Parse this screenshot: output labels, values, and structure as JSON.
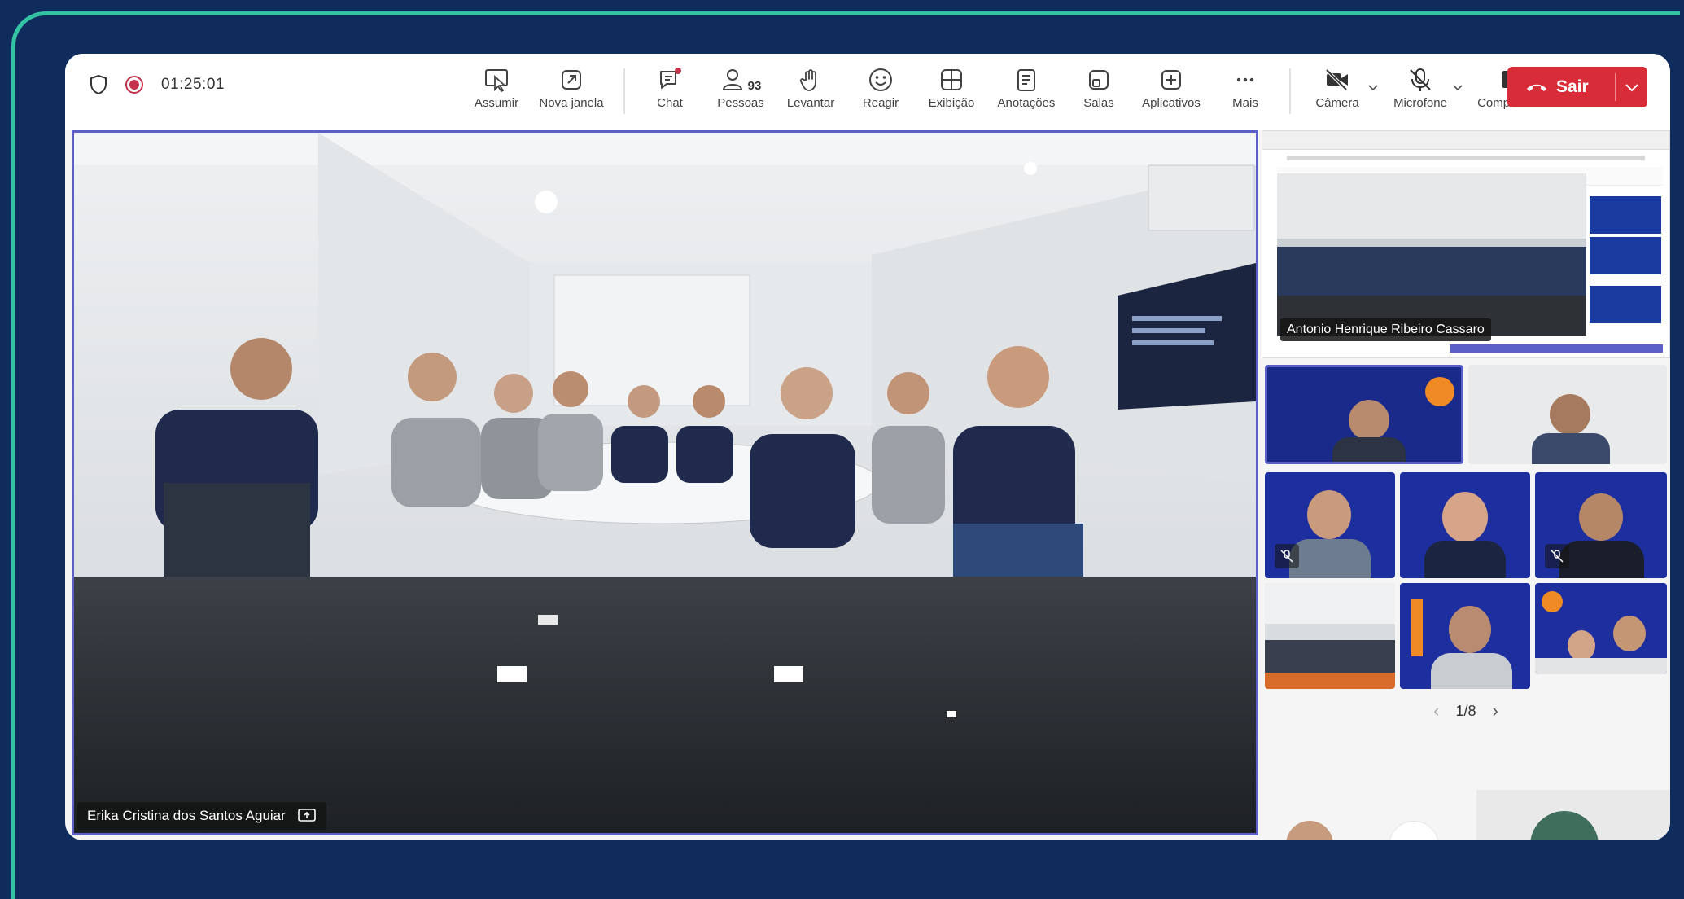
{
  "call": {
    "timer": "01:25:01"
  },
  "toolbar": {
    "items": [
      {
        "label": "Assumir",
        "icon": "take-control-icon"
      },
      {
        "label": "Nova janela",
        "icon": "pop-out-icon"
      },
      {
        "label": "Chat",
        "icon": "chat-icon"
      },
      {
        "label": "Pessoas",
        "icon": "people-icon",
        "count": "93"
      },
      {
        "label": "Levantar",
        "icon": "raise-hand-icon"
      },
      {
        "label": "Reagir",
        "icon": "react-icon"
      },
      {
        "label": "Exibição",
        "icon": "view-icon"
      },
      {
        "label": "Anotações",
        "icon": "notes-icon"
      },
      {
        "label": "Salas",
        "icon": "rooms-icon"
      },
      {
        "label": "Aplicativos",
        "icon": "apps-icon"
      },
      {
        "label": "Mais",
        "icon": "more-icon"
      },
      {
        "label": "Câmera",
        "icon": "camera-off-icon"
      },
      {
        "label": "Microfone",
        "icon": "mic-off-icon"
      },
      {
        "label": "Compartilhar",
        "icon": "share-icon"
      }
    ],
    "leave_label": "Sair"
  },
  "main_video": {
    "participant_name": "Erika Cristina dos Santos Aguiar"
  },
  "side_panel": {
    "shared_screen_name": "Antonio Henrique Ribeiro Cassaro",
    "pager": "1/8"
  },
  "colors": {
    "accent": "#5b5fc7",
    "leave": "#d92c39",
    "frame": "#34c3a3",
    "background": "#0f2c5c"
  }
}
